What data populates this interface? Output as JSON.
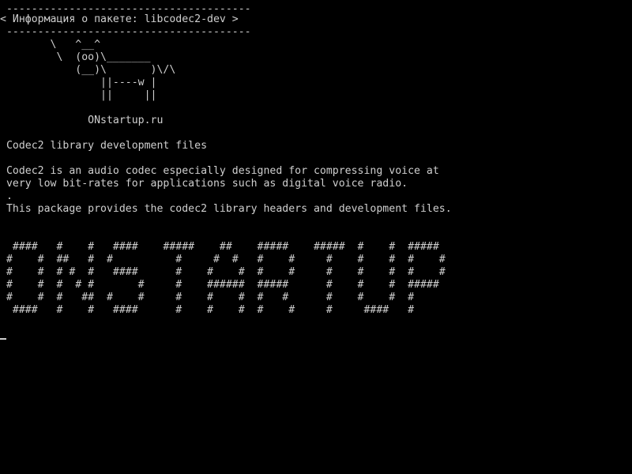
{
  "terminal": {
    "cowsay_top_border": " ---------------------------------------",
    "cowsay_text": "< Информация о пакете: libcodec2-dev >",
    "cowsay_bottom_border": " ---------------------------------------",
    "cow_line1": "        \\   ^__^",
    "cow_line2": "         \\  (oo)\\_______",
    "cow_line3": "            (__)\\       )\\/\\",
    "cow_line4": "                ||----w |",
    "cow_line5": "                ||     ||",
    "site": "              ONstartup.ru",
    "summary": " Codec2 library development files",
    "desc_line1": " Codec2 is an audio codec especially designed for compressing voice at",
    "desc_line2": " very low bit-rates for applications such as digital voice radio.",
    "desc_line3": " .",
    "desc_line4": " This package provides the codec2 library headers and development files.",
    "banner_line1": "  ####   #    #   ####    #####    ##    #####    #####  #    #  #####",
    "banner_line2": " #    #  ##   #  #          #     #  #   #    #     #    #    #  #    #",
    "banner_line3": " #    #  # #  #   ####      #    #    #  #    #     #    #    #  #    #",
    "banner_line4": " #    #  #  # #       #     #    ######  #####      #    #    #  #####",
    "banner_line5": " #    #  #   ##  #    #     #    #    #  #   #      #    #    #  #",
    "banner_line6": "  ####   #    #   ####      #    #    #  #    #     #     ####   #"
  }
}
